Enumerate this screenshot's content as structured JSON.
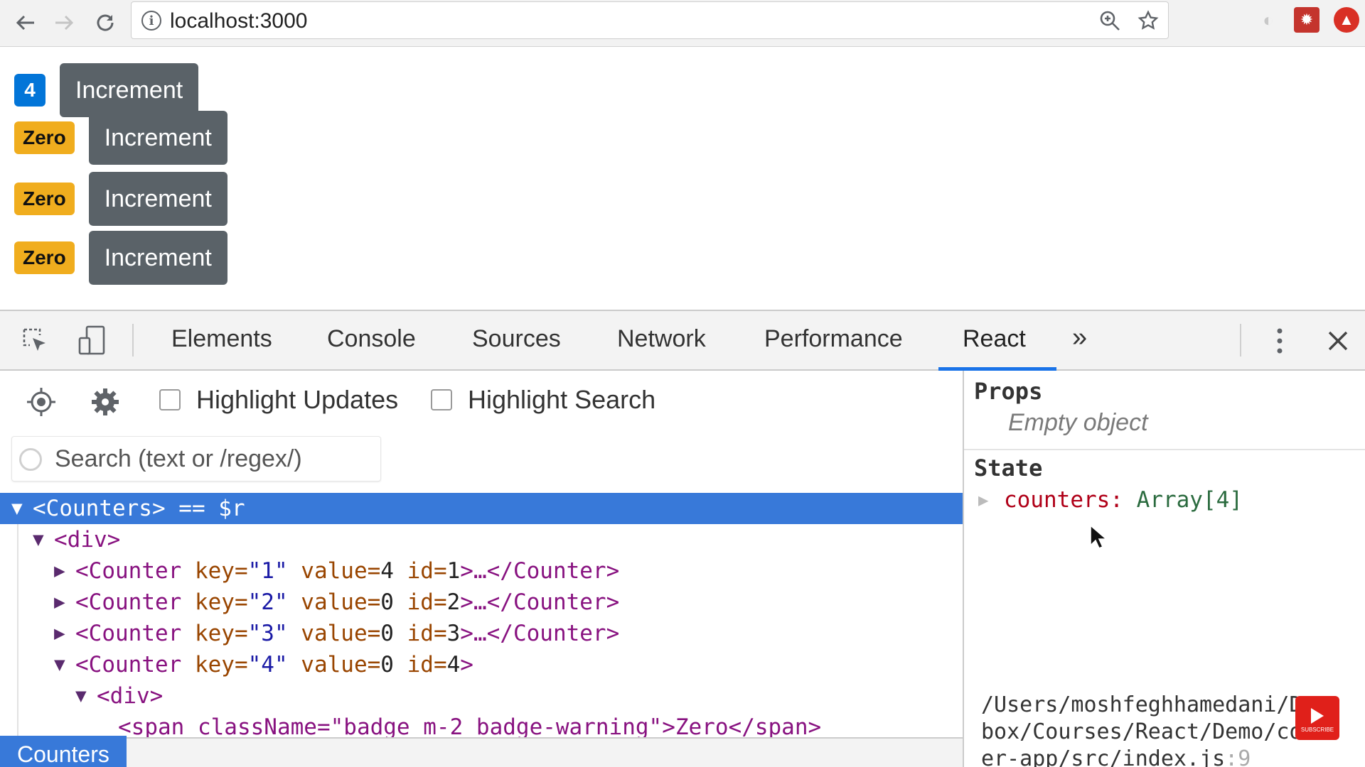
{
  "browser": {
    "url": "localhost:3000"
  },
  "page": {
    "counters": [
      {
        "badge": "4",
        "badge_style": "primary",
        "button": "Increment"
      },
      {
        "badge": "Zero",
        "badge_style": "warning",
        "button": "Increment"
      },
      {
        "badge": "Zero",
        "badge_style": "warning",
        "button": "Increment"
      },
      {
        "badge": "Zero",
        "badge_style": "warning",
        "button": "Increment"
      }
    ]
  },
  "devtools": {
    "tabs": [
      "Elements",
      "Console",
      "Sources",
      "Network",
      "Performance",
      "React"
    ],
    "active_tab": "React",
    "more_tabs": "»",
    "react": {
      "highlight_updates": "Highlight Updates",
      "highlight_search": "Highlight Search",
      "search_placeholder": "Search (text or /regex/)",
      "tree": {
        "root": "<Counters> == $r",
        "div": "<div>",
        "counters": [
          {
            "key": "\"1\"",
            "value": "4",
            "id": "1",
            "collapsed": true
          },
          {
            "key": "\"2\"",
            "value": "0",
            "id": "2",
            "collapsed": true
          },
          {
            "key": "\"3\"",
            "value": "0",
            "id": "3",
            "collapsed": true
          },
          {
            "key": "\"4\"",
            "value": "0",
            "id": "4",
            "collapsed": false
          }
        ],
        "inner_div": "<div>",
        "span_line": "<span className=\"badge m-2 badge-warning\">Zero</span>"
      },
      "breadcrumb": "Counters",
      "props_title": "Props",
      "props_empty": "Empty object",
      "state_title": "State",
      "state_key": "counters:",
      "state_value": "Array[4]",
      "source_path": "/Users/moshfeghhamedani/Dropbox/Courses/React/Demo/counter-app/src/index.js",
      "source_line": ":9"
    }
  },
  "colors": {
    "primary": "#0275d8",
    "warning": "#f0ad1e",
    "button": "#5a6268",
    "selection": "#3879d9",
    "tab_underline": "#1a73e8"
  },
  "icons": [
    "back-icon",
    "forward-icon",
    "reload-icon",
    "info-icon",
    "zoom-icon",
    "star-icon",
    "extension-icon",
    "react-extension-icon",
    "update-icon",
    "inspect-icon",
    "device-icon",
    "more-vert-icon",
    "close-icon",
    "target-icon",
    "gear-icon",
    "search-icon"
  ]
}
